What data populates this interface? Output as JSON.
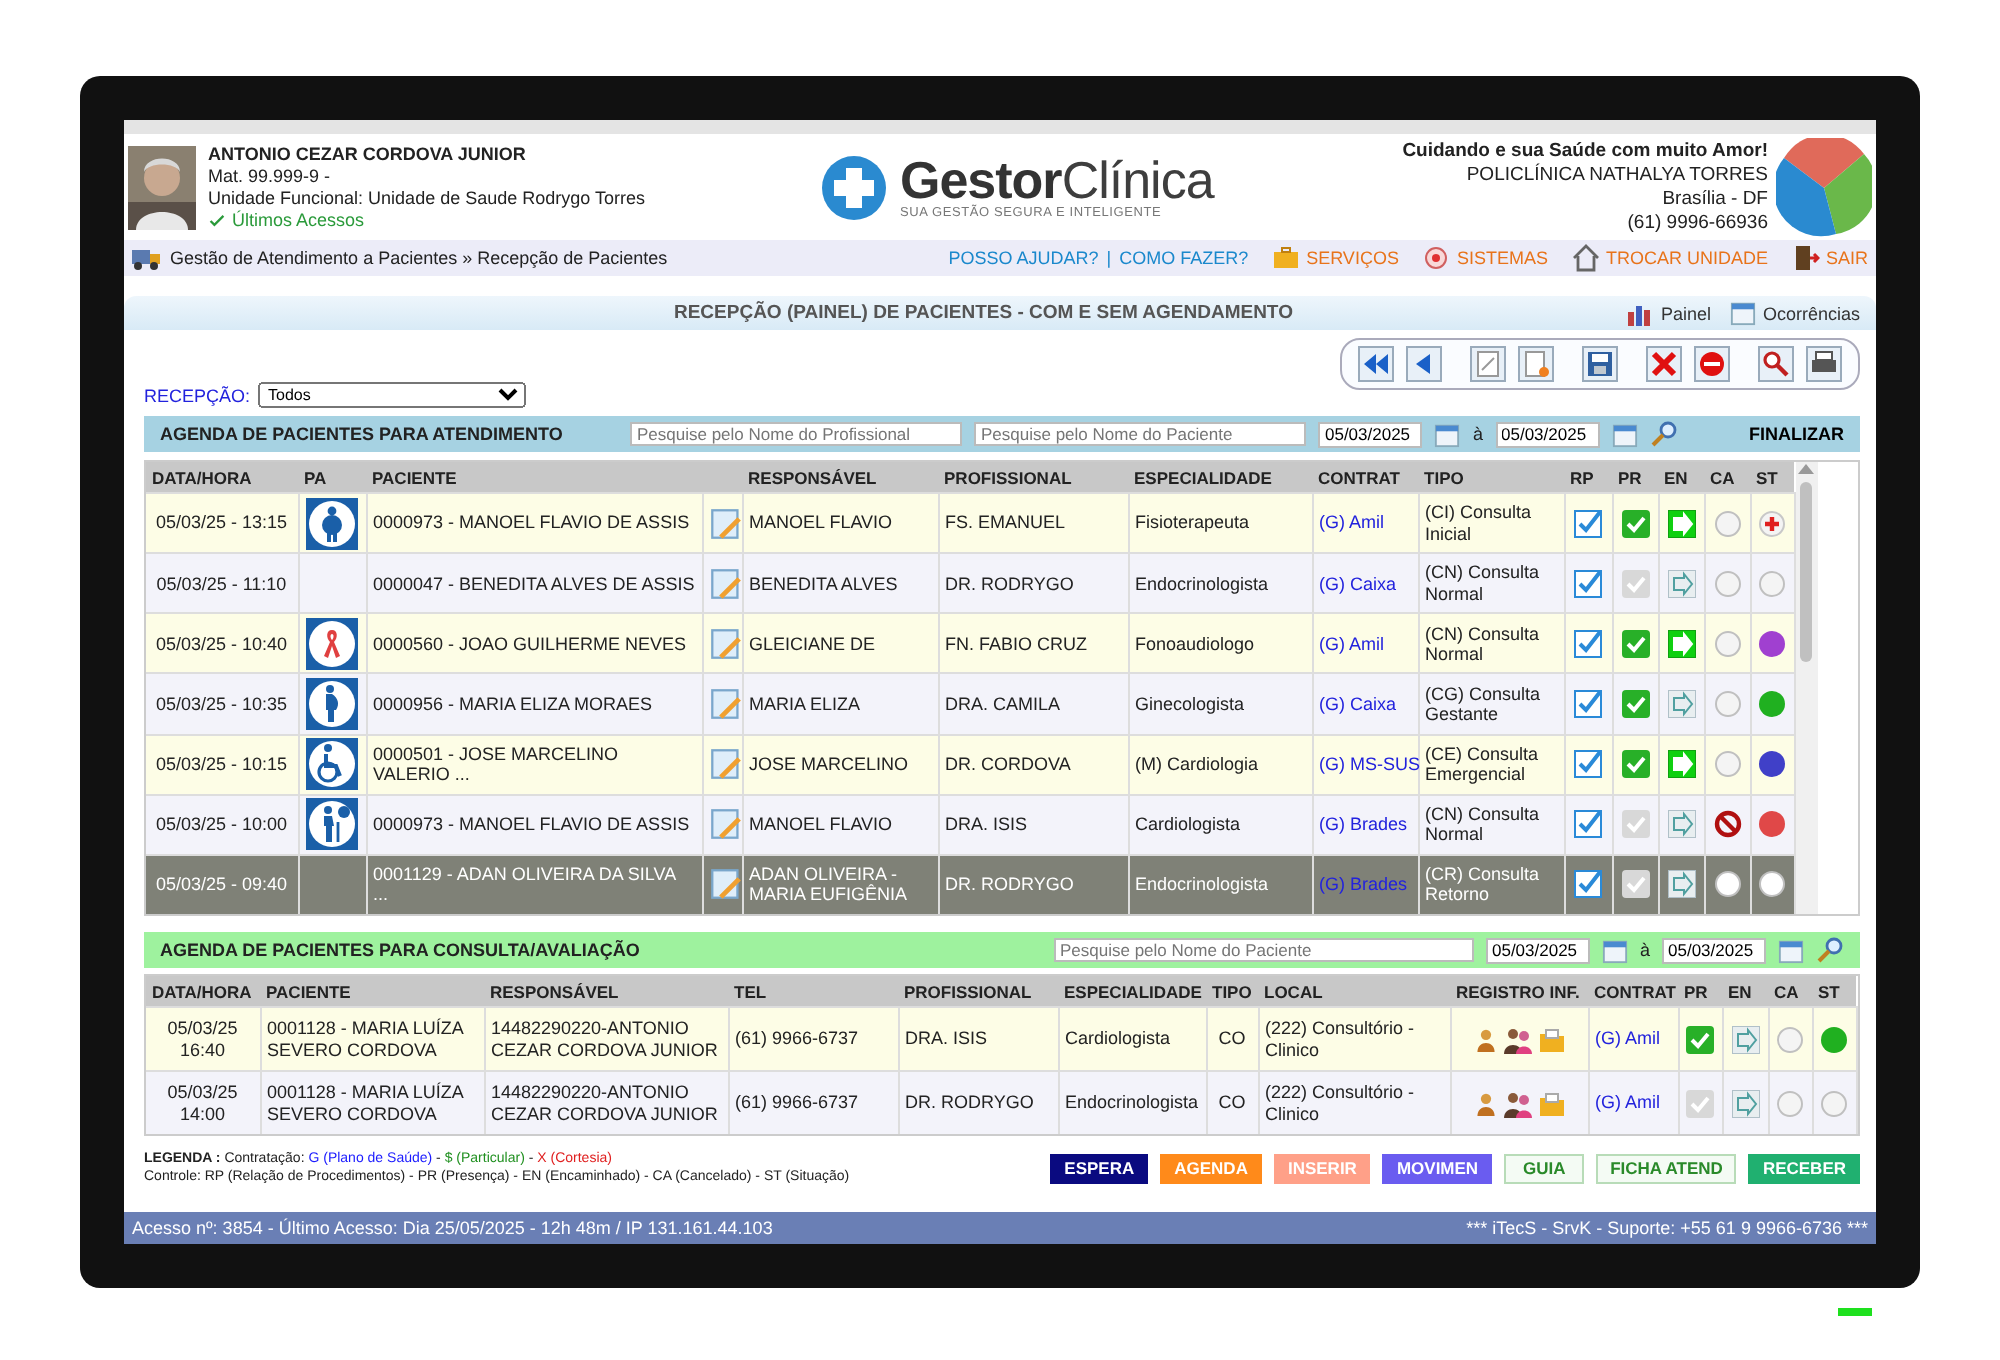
{
  "user": {
    "name": "ANTONIO CEZAR CORDOVA JUNIOR",
    "mat": "Mat. 99.999-9  -",
    "unit": "Unidade Funcional: Unidade de Saude Rodrygo Torres",
    "last_access": "Últimos Acessos"
  },
  "logo": {
    "brand": "**Gestor**Clínica",
    "tagline": "SUA GESTÃO SEGURA E INTELIGENTE"
  },
  "clinic": {
    "slogan": "Cuidando e sua Saúde com muito Amor!",
    "name": "POLICLÍNICA NATHALYA TORRES",
    "city": "Brasília - DF",
    "phone": "(61) 9996-66936"
  },
  "breadcrumb": "Gestão de Atendimento a Pacientes » Recepção de Pacientes",
  "nav_separator": "|",
  "nav_links": [
    {
      "label": "POSSO AJUDAR?",
      "kind": "help"
    },
    {
      "label": "COMO FAZER?",
      "kind": "howto"
    },
    {
      "label": "SERVIÇOS",
      "kind": "services"
    },
    {
      "label": "SISTEMAS",
      "kind": "systems"
    },
    {
      "label": "TROCAR UNIDADE",
      "kind": "unit"
    },
    {
      "label": "SAIR",
      "kind": "exit"
    }
  ],
  "page_title": "RECEPÇÃO (PAINEL) DE PACIENTES - COM E SEM AGENDAMENTO",
  "page_actions": [
    {
      "label": "Painel",
      "kind": "panel"
    },
    {
      "label": "Ocorrências",
      "kind": "calendar"
    }
  ],
  "reception": {
    "label": "RECEPÇÃO:",
    "value": "Todos"
  },
  "agenda": {
    "title": "AGENDA DE PACIENTES PARA ATENDIMENTO",
    "professional_search": {
      "placeholder": "Pesquise pelo Nome do Profissional"
    },
    "patient_search": {
      "placeholder": "Pesquise pelo Nome do Paciente"
    },
    "date_from": "05/03/2025",
    "date_sep": "à",
    "date_to": "05/03/2025",
    "finalize": "FINALIZAR",
    "columns": [
      "DATA/HORA",
      "PA",
      "PACIENTE",
      "RESPONSÁVEL",
      "PROFISSIONAL",
      "ESPECIALIDADE",
      "CONTRAT",
      "TIPO",
      "RP",
      "PR",
      "EN",
      "CA",
      "ST"
    ],
    "rows": [
      {
        "datetime": "05/03/25 - 13:15",
        "pa": {
          "kind": "obese"
        },
        "patient": "0000973 - MANOEL FLAVIO DE ASSIS",
        "responsible": "MANOEL FLAVIO",
        "professional": "FS. EMANUEL",
        "specialty": "Fisioterapeuta",
        "contract": "(G) Amil",
        "type": "(CI) Consulta Inicial",
        "rp": true,
        "pr": true,
        "en": true,
        "ca": false,
        "st": {
          "kind": "cross"
        },
        "selected": false
      },
      {
        "datetime": "05/03/25 - 11:10",
        "patient": "0000047 - BENEDITA ALVES DE ASSIS",
        "responsible": "BENEDITA ALVES",
        "professional": "DR. RODRYGO",
        "specialty": "Endocrinologista",
        "contract": "(G) Caixa",
        "type": "(CN) Consulta Normal",
        "rp": true,
        "pr": false,
        "en": false,
        "ca": false,
        "st": {
          "kind": "empty"
        },
        "selected": false
      },
      {
        "datetime": "05/03/25 - 10:40",
        "pa": {
          "kind": "ribbon"
        },
        "patient": "0000560 - JOAO GUILHERME NEVES",
        "responsible": "GLEICIANE DE",
        "professional": "FN. FABIO CRUZ",
        "specialty": "Fonoaudiologo",
        "contract": "(G) Amil",
        "type": "(CN) Consulta Normal",
        "rp": true,
        "pr": true,
        "en": true,
        "ca": false,
        "st": {
          "kind": "dot",
          "color": "#a040d0"
        },
        "selected": false
      },
      {
        "datetime": "05/03/25 - 10:35",
        "pa": {
          "kind": "pregnant"
        },
        "patient": "0000956 - MARIA ELIZA MORAES",
        "responsible": "MARIA ELIZA",
        "professional": "DRA. CAMILA",
        "specialty": "Ginecologista",
        "contract": "(G) Caixa",
        "type": "(CG) Consulta Gestante",
        "rp": true,
        "pr": true,
        "en": false,
        "ca": false,
        "st": {
          "kind": "dot",
          "color": "#20b020"
        },
        "selected": false
      },
      {
        "datetime": "05/03/25 - 10:15",
        "pa": {
          "kind": "wheelchair"
        },
        "patient": "0000501 - JOSE MARCELINO VALERIO ...",
        "responsible": "JOSE MARCELINO",
        "professional": "DR. CORDOVA",
        "specialty": "(M) Cardiologia",
        "contract": "(G) MS-SUS",
        "type": "(CE) Consulta Emergencial",
        "rp": true,
        "pr": true,
        "en": true,
        "ca": false,
        "st": {
          "kind": "dot",
          "color": "#4040c8"
        },
        "selected": false
      },
      {
        "datetime": "05/03/25 - 10:00",
        "pa": {
          "kind": "elderly"
        },
        "patient": "0000973 - MANOEL FLAVIO DE ASSIS",
        "responsible": "MANOEL FLAVIO",
        "professional": "DRA. ISIS",
        "specialty": "Cardiologista",
        "contract": "(G) Brades",
        "type": "(CN) Consulta Normal",
        "rp": true,
        "pr": false,
        "en": false,
        "ca": true,
        "st": {
          "kind": "dot",
          "color": "#e04848"
        },
        "selected": false
      },
      {
        "datetime": "05/03/25 - 09:40",
        "patient": "0001129 - ADAN OLIVEIRA DA SILVA ...",
        "responsible": "ADAN OLIVEIRA - MARIA EUFIGÊNIA",
        "professional": "DR. RODRYGO",
        "specialty": "Endocrinologista",
        "contract": "(G) Brades",
        "type": "(CR) Consulta Retorno",
        "rp": true,
        "pr": false,
        "en": false,
        "ca": false,
        "st": {
          "kind": "empty"
        },
        "selected": true
      }
    ]
  },
  "consult": {
    "title": "AGENDA DE PACIENTES PARA CONSULTA/AVALIAÇÃO",
    "patient_search": {
      "placeholder": "Pesquise pelo Nome do Paciente"
    },
    "date_from": "05/03/2025",
    "date_sep": "à",
    "date_to": "05/03/2025",
    "columns": [
      "DATA/HORA",
      "PACIENTE",
      "RESPONSÁVEL",
      "TEL",
      "PROFISSIONAL",
      "ESPECIALIDADE",
      "TIPO",
      "LOCAL",
      "REGISTRO INF.",
      "CONTRAT",
      "PR",
      "EN",
      "CA",
      "ST"
    ],
    "rows": [
      {
        "date": "05/03/25",
        "time": "16:40",
        "patient": "0001128 - MARIA LUÍZA SEVERO CORDOVA",
        "responsible": "14482290220-ANTONIO CEZAR CORDOVA JUNIOR",
        "tel": "(61) 9966-6737",
        "professional": "DRA. ISIS",
        "specialty": "Cardiologista",
        "type": "CO",
        "local": "(222) Consultório - Clinico",
        "contract": "(G) Amil",
        "pr": true,
        "en": false,
        "ca": false,
        "st": {
          "kind": "dot",
          "color": "#20b020"
        }
      },
      {
        "date": "05/03/25",
        "time": "14:00",
        "patient": "0001128 - MARIA LUÍZA SEVERO CORDOVA",
        "responsible": "14482290220-ANTONIO CEZAR CORDOVA JUNIOR",
        "tel": "(61) 9966-6737",
        "professional": "DR. RODRYGO",
        "specialty": "Endocrinologista",
        "type": "CO",
        "local": "(222) Consultório - Clinico",
        "contract": "(G) Amil",
        "pr": false,
        "en": false,
        "ca": false,
        "st": {
          "kind": "empty"
        }
      }
    ]
  },
  "legend": {
    "line1": [
      {
        "text": "LEGENDA :",
        "kind": "bold"
      },
      {
        "text": " Contratação: "
      },
      {
        "text": "G (Plano de Saúde)",
        "color": "#1a1aff"
      },
      {
        "text": " - "
      },
      {
        "text": "$ (Particular)",
        "color": "#209020"
      },
      {
        "text": " - "
      },
      {
        "text": "X (Cortesia)",
        "color": "#e02020"
      }
    ],
    "line2": "Controle: RP (Relação de Procedimentos) - PR (Presença) - EN (Encaminhado) - CA (Cancelado) - ST (Situação)"
  },
  "buttons": [
    {
      "label": "ESPERA",
      "kind": "solid",
      "color": "#0a0a80"
    },
    {
      "label": "AGENDA",
      "kind": "solid",
      "color": "#ff8a1a"
    },
    {
      "label": "INSERIR",
      "kind": "solid",
      "color": "#ffa088"
    },
    {
      "label": "MOVIMEN",
      "kind": "solid",
      "color": "#6a5cf0"
    },
    {
      "label": "GUIA",
      "kind": "outline",
      "color": "#2a8a2a"
    },
    {
      "label": "FICHA ATEND",
      "kind": "outline",
      "color": "#2a8a2a"
    },
    {
      "label": "RECEBER",
      "kind": "solid",
      "color": "#20b070"
    }
  ],
  "status_bar": {
    "left": "Acesso nº:  3854 - Último Acesso:  Dia 25/05/2025 - 12h 48m / IP  131.161.44.103",
    "right": "*** iTecS - SrvK - Suporte: +55 61 9 9966-6736 ***"
  }
}
